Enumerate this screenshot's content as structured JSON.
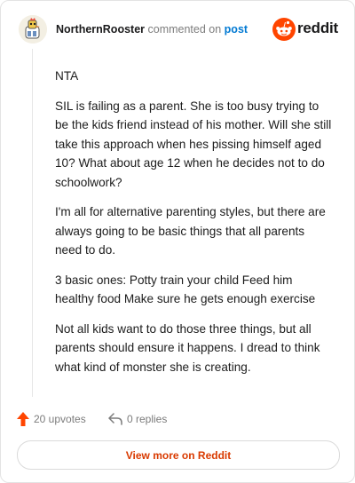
{
  "header": {
    "author": "NorthernRooster",
    "action": "commented on",
    "post_link": "post",
    "brand": "reddit"
  },
  "comment": {
    "paragraphs": [
      "NTA",
      "SIL is failing as a parent. She is too busy trying to be the kids friend instead of his mother. Will she still take this approach when hes pissing himself aged 10? What about age 12 when he decides not to do schoolwork?",
      "I'm all for alternative parenting styles, but there are always going to be basic things that all parents need to do.",
      "3 basic ones: Potty train your child Feed him healthy food Make sure he gets enough exercise",
      "Not all kids want to do those three things, but all parents should ensure it happens. I dread to think what kind of monster she is creating."
    ]
  },
  "footer": {
    "upvotes": "20 upvotes",
    "replies": "0 replies",
    "view_more": "View more on Reddit"
  },
  "icons": {
    "upvote": "upvote-arrow-icon",
    "reply": "reply-arrow-icon",
    "brand": "reddit-logo-icon",
    "avatar": "rooster-avatar-icon"
  },
  "colors": {
    "accent": "#ff4500",
    "link": "#0079d3",
    "view_more_text": "#d93a00"
  }
}
